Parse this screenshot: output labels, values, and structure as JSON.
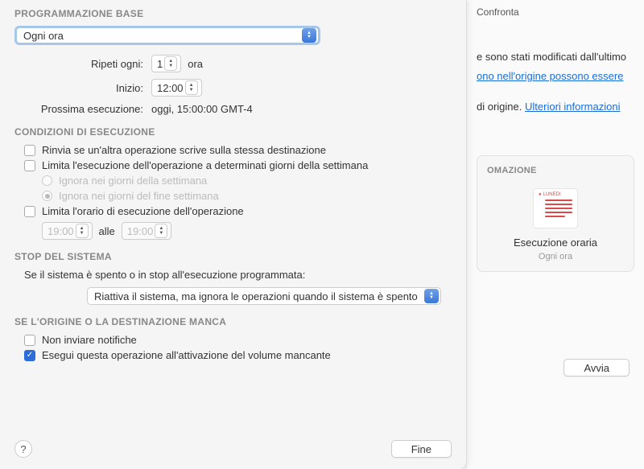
{
  "right": {
    "confronta": "Confronta",
    "text1_partial": "e sono stati modificati dall'ultimo",
    "link1_partial": "ono nell'origine possono essere",
    "text2_partial": "di origine.",
    "link2": "Ulteriori informazioni",
    "automation_heading_partial": "OMAZIONE",
    "card_icon_label": "LUNEDI",
    "card_title": "Esecuzione oraria",
    "card_sub": "Ogni ora",
    "start_btn": "Avvia"
  },
  "schedule": {
    "section_title": "PROGRAMMAZIONE BASE",
    "frequency": "Ogni ora",
    "repeat_label": "Ripeti ogni:",
    "repeat_value": "1",
    "repeat_unit": "ora",
    "start_label": "Inizio:",
    "start_value": "12:00",
    "next_label": "Prossima esecuzione:",
    "next_value": "oggi, 15:00:00 GMT-4"
  },
  "conditions": {
    "section_title": "CONDIZIONI DI ESECUZIONE",
    "defer": "Rinvia se un'altra operazione scrive sulla stessa destinazione",
    "limit_days": "Limita l'esecuzione dell'operazione a determinati giorni della settimana",
    "ignore_weekdays": "Ignora nei giorni della settimana",
    "ignore_weekend": "Ignora nei giorni del fine settimana",
    "limit_time": "Limita l'orario di esecuzione dell'operazione",
    "time_from": "19:00",
    "time_sep": "alle",
    "time_to": "19:00"
  },
  "system_stop": {
    "section_title": "STOP DEL SISTEMA",
    "intro": "Se il sistema è spento o in stop all'esecuzione programmata:",
    "option": "Riattiva il sistema, ma ignora le operazioni quando il sistema è spento"
  },
  "missing": {
    "section_title": "SE L'ORIGINE O LA DESTINAZIONE MANCA",
    "no_notify": "Non inviare notifiche",
    "run_on_mount": "Esegui questa operazione all'attivazione del volume mancante"
  },
  "footer": {
    "help": "?",
    "done": "Fine"
  }
}
